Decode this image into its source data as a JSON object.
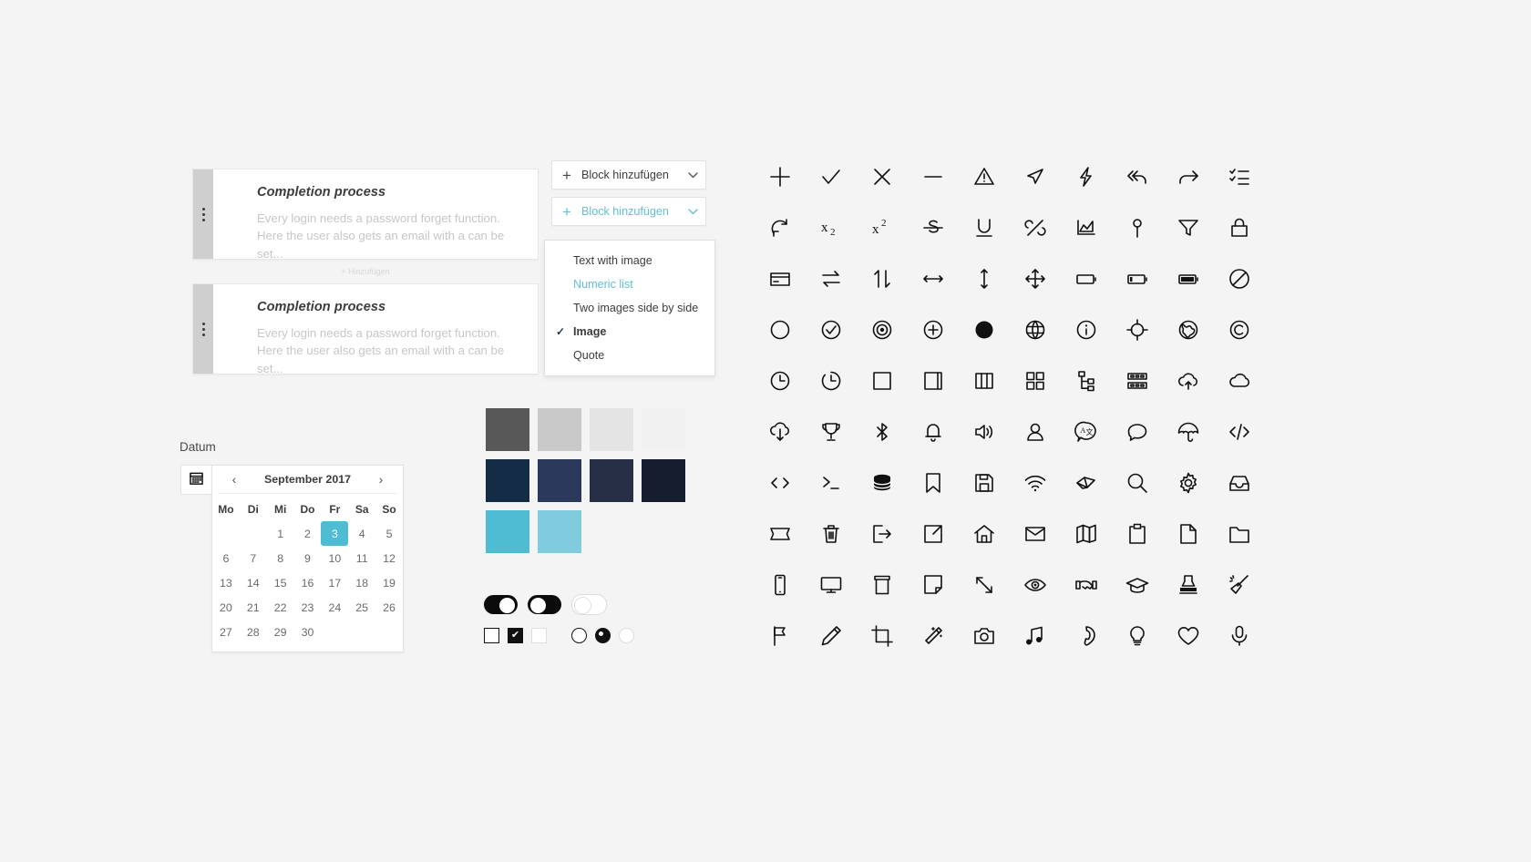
{
  "page": {
    "background": "#f4f4f4",
    "accent": "#62c0d4",
    "selection": "#4fbcd4"
  },
  "cards": {
    "add_label": "+ Hinzufügen",
    "items": [
      {
        "title": "Completion process",
        "text": "Every login needs a password forget function. Here the user also gets an email with a can be set..."
      },
      {
        "title": "Completion process",
        "text": "Every login needs a password forget function. Here the user also gets an email with a can be set..."
      }
    ]
  },
  "block_buttons": [
    {
      "label": "Block hinzufügen",
      "state": "default"
    },
    {
      "label": "Block hinzufügen",
      "state": "accent"
    }
  ],
  "menu": {
    "items": [
      {
        "label": "Text with image",
        "state": "default",
        "checked": false
      },
      {
        "label": "Numeric list",
        "state": "accent",
        "checked": false
      },
      {
        "label": "Two images side by side",
        "state": "default",
        "checked": false
      },
      {
        "label": "Image",
        "state": "selected",
        "checked": true
      },
      {
        "label": "Quote",
        "state": "default",
        "checked": false
      }
    ],
    "check_glyph": "✓"
  },
  "datepicker": {
    "field_label": "Datum",
    "month_title": "September 2017",
    "prev_glyph": "‹",
    "next_glyph": "›",
    "weekdays": [
      "Mo",
      "Di",
      "Mi",
      "Do",
      "Fr",
      "Sa",
      "So"
    ],
    "selected_day": 3,
    "weeks": [
      [
        "",
        "",
        "1",
        "2",
        "3",
        "4",
        "5"
      ],
      [
        "6",
        "7",
        "8",
        "9",
        "10",
        "11",
        "12"
      ],
      [
        "13",
        "14",
        "15",
        "16",
        "17",
        "18",
        "19"
      ],
      [
        "20",
        "21",
        "22",
        "23",
        "24",
        "25",
        "26"
      ],
      [
        "27",
        "28",
        "29",
        "30",
        "",
        "",
        ""
      ]
    ]
  },
  "swatches": {
    "rows": [
      [
        "#585858",
        "#c9c9c9",
        "#e4e4e4",
        "#f1f1f1"
      ],
      [
        "#152c47",
        "#2b3a5c",
        "#262f45",
        "#151d2e"
      ],
      [
        "#4fbcd4",
        "#80cbdd"
      ]
    ]
  },
  "controls": {
    "toggles": [
      {
        "name": "toggle-on",
        "state": "on"
      },
      {
        "name": "toggle-mid",
        "state": "mid"
      },
      {
        "name": "toggle-off",
        "state": "off"
      }
    ],
    "checkboxes": [
      {
        "name": "checkbox-empty",
        "state": "empty"
      },
      {
        "name": "checkbox-checked",
        "state": "checked"
      },
      {
        "name": "checkbox-disabled",
        "state": "disabled"
      }
    ],
    "check_glyph": "✔",
    "radios": [
      {
        "name": "radio-empty",
        "state": "empty"
      },
      {
        "name": "radio-checked",
        "state": "checked"
      },
      {
        "name": "radio-disabled",
        "state": "disabled"
      }
    ]
  },
  "icon_grid": {
    "columns": 10,
    "rows": [
      [
        "plus-icon",
        "check-icon",
        "close-icon",
        "minus-icon",
        "warning-triangle-icon",
        "send-icon",
        "flash-icon",
        "reply-all-icon",
        "redo-icon",
        "checklist-icon"
      ],
      [
        "refresh-icon",
        "subscript-icon",
        "superscript-icon",
        "strikethrough-icon",
        "underline-icon",
        "unlink-icon",
        "area-chart-icon",
        "pin-icon",
        "filter-icon",
        "lock-icon"
      ],
      [
        "credit-card-icon",
        "swap-horizontal-icon",
        "sort-vertical-icon",
        "arrow-horizontal-icon",
        "arrow-vertical-icon",
        "move-icon",
        "battery-empty-icon",
        "battery-low-icon",
        "battery-full-icon",
        "no-entry-icon"
      ],
      [
        "circle-icon",
        "check-circle-icon",
        "record-icon",
        "plus-circle-icon",
        "circle-filled-icon",
        "globe-grid-icon",
        "info-icon",
        "crosshair-icon",
        "globe-earth-icon",
        "copyright-icon"
      ],
      [
        "clock-icon",
        "clock-quarter-icon",
        "square-icon",
        "window-icon",
        "columns-icon",
        "grid-icon",
        "sitemap-icon",
        "server-icon",
        "cloud-upload-icon",
        "cloud-icon"
      ],
      [
        "cloud-download-icon",
        "trophy-icon",
        "bluetooth-icon",
        "bell-icon",
        "volume-icon",
        "user-icon",
        "translate-icon",
        "comment-icon",
        "umbrella-icon",
        "code-tag-icon"
      ],
      [
        "code-brackets-icon",
        "terminal-icon",
        "database-icon",
        "bookmark-icon",
        "save-icon",
        "wifi-icon",
        "origami-icon",
        "search-icon",
        "gear-icon",
        "inbox-icon"
      ],
      [
        "ticket-icon",
        "trash-icon",
        "logout-icon",
        "external-link-icon",
        "home-icon",
        "mail-icon",
        "map-icon",
        "clipboard-icon",
        "file-icon",
        "folder-icon"
      ],
      [
        "phone-mobile-icon",
        "monitor-icon",
        "archive-box-icon",
        "note-icon",
        "resize-diagonal-icon",
        "eye-icon",
        "handshake-icon",
        "graduation-cap-icon",
        "stamp-icon",
        "magic-broom-icon"
      ],
      [
        "flag-icon",
        "pencil-icon",
        "crop-icon",
        "magic-wand-icon",
        "camera-icon",
        "music-icon",
        "phone-call-icon",
        "lightbulb-icon",
        "heart-icon",
        "microphone-icon"
      ]
    ]
  }
}
